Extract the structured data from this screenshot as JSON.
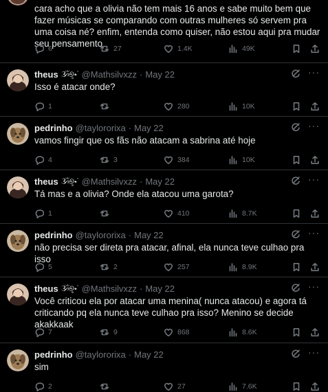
{
  "tweets": [
    {
      "text": "cara acho que a olivia não tem mais 16 anos e sabe muito bem que fazer músicas se comparando com outras mulheres só servem pra uma coisa né? enfim, entenda como quiser, não estou aqui pra mudar seu pensamento",
      "replies": "6",
      "retweets": "27",
      "likes": "1.4K",
      "views": "49K"
    },
    {
      "name": "theus",
      "emoji": "ૐ୭̥⋆˙",
      "handle": "@Mathsilvxzz",
      "date": "May 22",
      "text": "Isso é atacar onde?",
      "replies": "1",
      "retweets": "",
      "likes": "280",
      "views": "10K"
    },
    {
      "name": "pedrinho",
      "handle": "@tayloror‌ixa",
      "date": "May 22",
      "text": "vamos fingir que os fãs não atacam a sabrina até hoje",
      "replies": "4",
      "retweets": "3",
      "likes": "384",
      "views": "10K"
    },
    {
      "name": "theus",
      "emoji": "ૐ୭̥⋆˙",
      "handle": "@Mathsilvxzz",
      "date": "May 22",
      "text": "Tá mas e a olivia? Onde ela atacou uma garota?",
      "replies": "1",
      "retweets": "",
      "likes": "410",
      "views": "8.7K"
    },
    {
      "name": "pedrinho",
      "handle": "@tayloror‌ixa",
      "date": "May 22",
      "text": "não precisa ser direta pra atacar, afinal, ela nunca teve culhao pra isso",
      "replies": "5",
      "retweets": "2",
      "likes": "257",
      "views": "8.9K"
    },
    {
      "name": "theus",
      "emoji": "ૐ୭̥⋆˙",
      "handle": "@Mathsilvxzz",
      "date": "May 22",
      "text": "Você criticou ela por atacar uma menina( nunca atacou) e agora tá criticando pq ela nunca teve culhao pra isso? Menino se decide akakkaak",
      "replies": "7",
      "retweets": "9",
      "likes": "868",
      "views": "8.6K"
    },
    {
      "name": "pedrinho",
      "handle": "@tayloror‌ixa",
      "date": "May 22",
      "text": "sim",
      "replies": "2",
      "retweets": "",
      "likes": "27",
      "views": "7.6K"
    }
  ],
  "colors": {
    "background": "#000000",
    "text": "#e7e9ea",
    "muted": "#71767b",
    "divider": "#2f3336"
  },
  "icons": [
    "reply-icon",
    "retweet-icon",
    "like-icon",
    "views-icon",
    "bookmark-icon",
    "share-icon",
    "grok-icon",
    "more-icon"
  ]
}
